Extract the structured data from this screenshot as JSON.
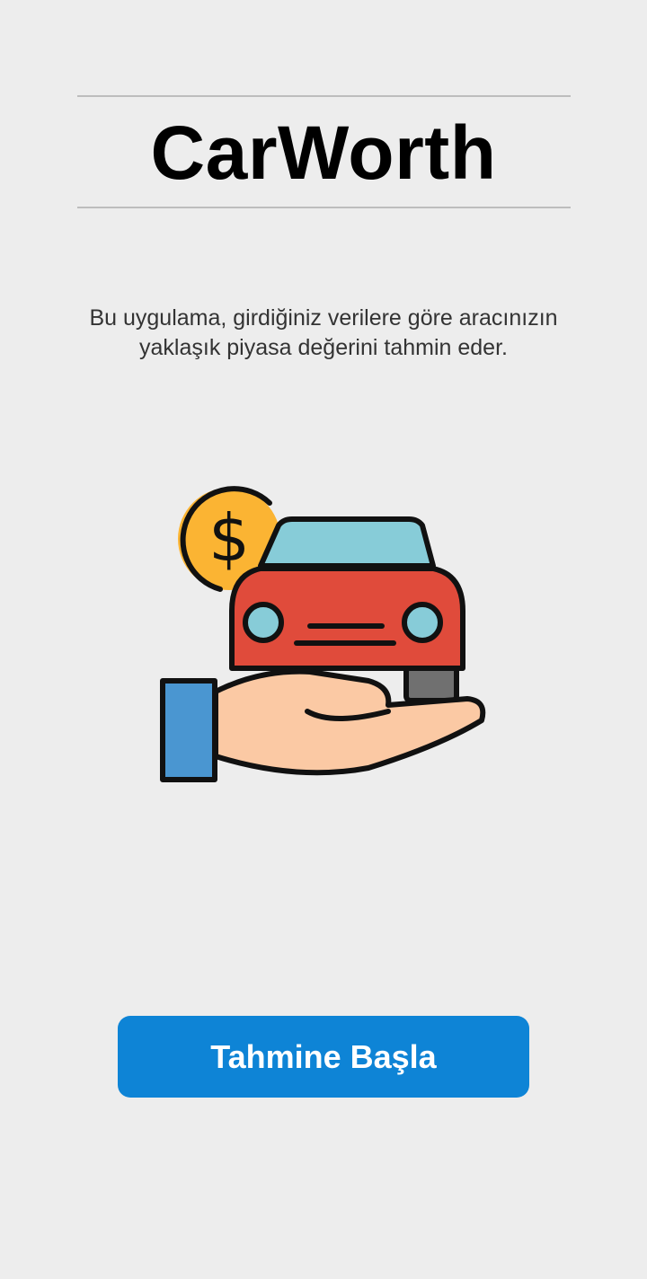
{
  "app": {
    "title": "CarWorth",
    "description": "Bu uygulama, girdiğiniz verilere göre aracınızın yaklaşık piyasa değerini tahmin eder."
  },
  "illustration": {
    "icons": [
      "dollar-coin-icon",
      "car-icon",
      "hand-icon"
    ]
  },
  "actions": {
    "start_label": "Tahmine Başla"
  },
  "colors": {
    "background": "#ededed",
    "accent": "#0e84d6",
    "divider": "#bdbdbd",
    "coin": "#fbb433",
    "car_body": "#e04b3b",
    "car_window": "#87ccd8",
    "sleeve": "#4a96d1",
    "skin": "#fbc9a4"
  }
}
